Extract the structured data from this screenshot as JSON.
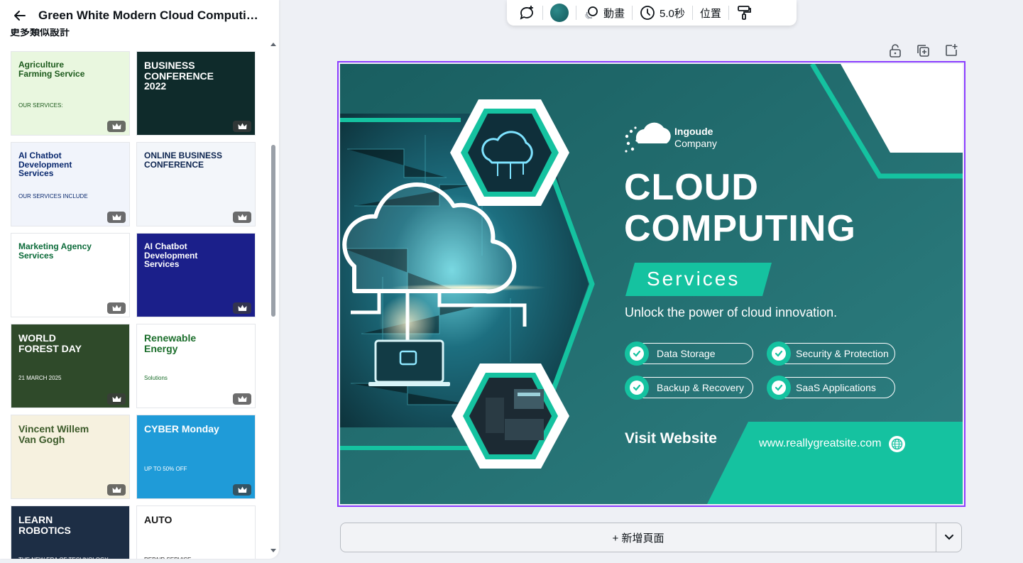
{
  "panel": {
    "title": "Green White Modern Cloud Computing S...",
    "cut_label": "更多類似設計"
  },
  "templates": [
    {
      "title": "Agriculture Farming Service",
      "sub": "OUR SERVICES:",
      "bg": "#e9f7df",
      "fg": "#1c5a1c"
    },
    {
      "title": "BUSINESS CONFERENCE 2022",
      "sub": "",
      "bg": "#0f2b2b",
      "fg": "#ffffff"
    },
    {
      "title": "AI Chatbot Development Services",
      "sub": "OUR SERVICES INCLUDE",
      "bg": "#f1f4fb",
      "fg": "#0b2a6f"
    },
    {
      "title": "ONLINE BUSINESS CONFERENCE",
      "sub": "",
      "bg": "#f3f6fa",
      "fg": "#0d2550"
    },
    {
      "title": "Marketing Agency Services",
      "sub": "",
      "bg": "#ffffff",
      "fg": "#0c6b3a"
    },
    {
      "title": "AI Chatbot Development Services",
      "sub": "",
      "bg": "#1b1f8a",
      "fg": "#ffffff"
    },
    {
      "title": "WORLD FOREST DAY",
      "sub": "21 MARCH 2025",
      "bg": "#2f4a2a",
      "fg": "#ffffff"
    },
    {
      "title": "Renewable Energy",
      "sub": "Solutions",
      "bg": "#ffffff",
      "fg": "#1b6e2b"
    },
    {
      "title": "Vincent Willem Van Gogh",
      "sub": "",
      "bg": "#f6f1df",
      "fg": "#3c5a2a"
    },
    {
      "title": "CYBER Monday",
      "sub": "UP TO 50% OFF",
      "bg": "#1f9bd8",
      "fg": "#ffffff"
    },
    {
      "title": "LEARN ROBOTICS",
      "sub": "THE NEW ERA OF TECHNOLOGY",
      "bg": "#1d2e45",
      "fg": "#ffffff"
    },
    {
      "title": "AUTO",
      "sub": "REPAIR SERVICE",
      "bg": "#ffffff",
      "fg": "#1a1a1a"
    }
  ],
  "toolbar": {
    "animate_label": "動畫",
    "duration_label": "5.0秒",
    "position_label": "位置"
  },
  "design": {
    "brand_name": "Ingoude",
    "brand_sub": "Company",
    "headline_1": "CLOUD",
    "headline_2": "COMPUTING",
    "services_label": "Services",
    "tagline": "Unlock the power of cloud innovation.",
    "features": [
      "Data Storage",
      "Security & Protection",
      "Backup & Recovery",
      "SaaS Applications"
    ],
    "visit_label": "Visit Website",
    "url": "www.reallygreatsite.com",
    "colors": {
      "teal_dark": "#1f6466",
      "teal_mid": "#2b7a7c",
      "accent": "#15c2a0"
    }
  },
  "add_page": {
    "label": "+ 新增頁面"
  }
}
